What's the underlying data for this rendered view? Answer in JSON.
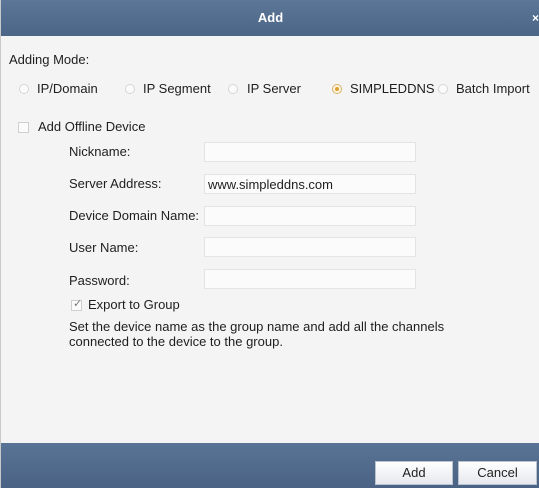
{
  "window": {
    "title": "Add",
    "close_glyph": "×"
  },
  "adding_mode": {
    "label": "Adding Mode:",
    "options": [
      {
        "label": "IP/Domain",
        "selected": false
      },
      {
        "label": "IP Segment",
        "selected": false
      },
      {
        "label": "IP Server",
        "selected": false
      },
      {
        "label": "SIMPLEDDNS",
        "selected": true
      },
      {
        "label": "Batch Import",
        "selected": false
      }
    ]
  },
  "offline_device": {
    "label": "Add Offline Device",
    "checked": false
  },
  "form": {
    "nickname": {
      "label": "Nickname:",
      "value": ""
    },
    "server_address": {
      "label": "Server Address:",
      "value": "www.simpleddns.com"
    },
    "device_domain_name": {
      "label": "Device Domain Name:",
      "value": ""
    },
    "user_name": {
      "label": "User Name:",
      "value": ""
    },
    "password": {
      "label": "Password:",
      "value": ""
    }
  },
  "export_to_group": {
    "label": "Export to Group",
    "checked": true,
    "description": "Set the device name as the group name and add all the channels connected to the device to the group."
  },
  "buttons": {
    "add": "Add",
    "cancel": "Cancel"
  },
  "colors": {
    "titlebar": "#566f92",
    "footer": "#536d8f",
    "radio_selected": "#e0a030"
  }
}
